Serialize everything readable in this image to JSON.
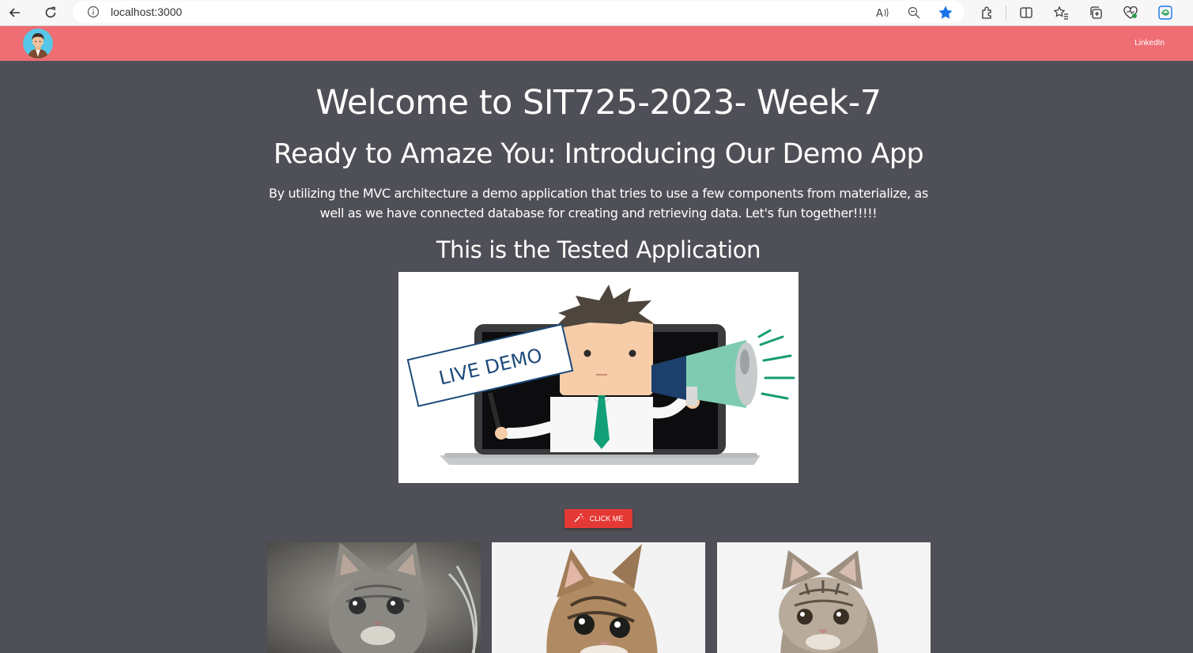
{
  "browser": {
    "url": "localhost:3000",
    "icons": [
      "back-icon",
      "refresh-icon",
      "info-icon",
      "read-aloud-icon",
      "zoom-out-icon",
      "favorite-star-icon",
      "extensions-icon",
      "split-screen-icon",
      "favorites-icon",
      "collections-icon",
      "browser-essentials-icon",
      "edge-icon"
    ],
    "star_color": "#1a73e8"
  },
  "navbar": {
    "color": "#ee6e73",
    "link_label": "LinkedIn"
  },
  "main": {
    "title": "Welcome to SIT725-2023- Week-7",
    "subtitle": "Ready to Amaze You: Introducing Our Demo App",
    "description": "By utilizing the MVC architecture a demo application that tries to use a few components from materialize, as well as we have connected database for creating and retrieving data. Let's fun together!!!!!",
    "section_title": "This is the Tested Application",
    "demo_sign": "LIVE DEMO",
    "button_label": "CLICK ME",
    "button_color": "#e53935",
    "background": "#4f5057"
  },
  "cards": [
    {
      "name": "kitten-card-1"
    },
    {
      "name": "kitten-card-2"
    },
    {
      "name": "kitten-card-3"
    }
  ]
}
